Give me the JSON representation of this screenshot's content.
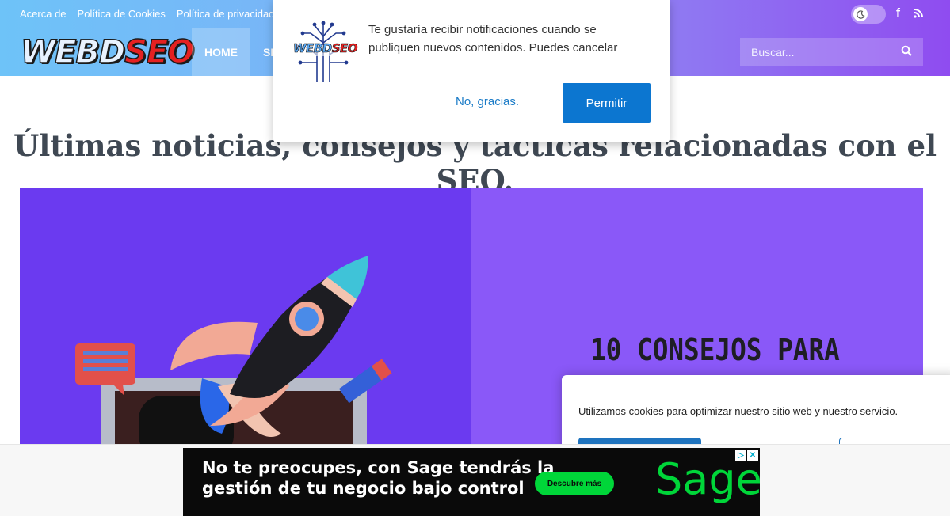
{
  "header": {
    "top_links": [
      "Acerca de",
      "Política de Cookies",
      "Política de privacidad"
    ],
    "logo": {
      "part1": "WEBD",
      "part2": "SEO"
    },
    "nav_items": [
      "HOME",
      "SE"
    ],
    "search": {
      "placeholder": "Buscar..."
    },
    "icons": [
      "moon-icon",
      "facebook-icon",
      "rss-icon",
      "search-icon"
    ]
  },
  "notification_prompt": {
    "message": "Te gustaría recibir notificaciones cuando se publiquen nuevos contenidos. Puedes cancelar",
    "decline_label": "No, gracias.",
    "allow_label": "Permitir"
  },
  "main": {
    "headline": "Últimas noticias, consejos y tácticas relacionadas con el SEO.",
    "featured_image_text": "10 CONSEJOS PARA"
  },
  "cookie_banner": {
    "text": "Utilizamos cookies para optimizar nuestro sitio web y nuestro servicio."
  },
  "ad": {
    "text_line1": "No te preocupes, con Sage tendrás la",
    "text_line2": "gestión de tu negocio bajo control",
    "cta_label": "Descubre más",
    "brand": "Sage"
  },
  "colors": {
    "header_start": "#6ec3f8",
    "header_end": "#8f4cf0",
    "allow_button": "#0c76d0",
    "ad_accent": "#00d639"
  }
}
